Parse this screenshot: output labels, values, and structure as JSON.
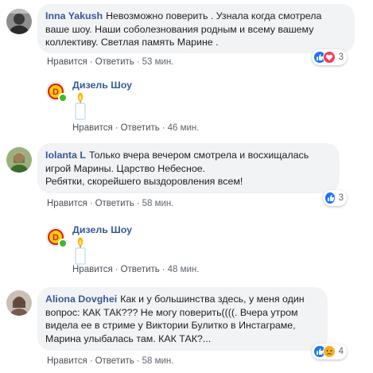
{
  "comments": [
    {
      "author": "Inna Yakush",
      "text": "Невозможно поверить . Узнала когда смотрела ваше шоу. Наши соболезнования родным и всему вашему коллективу. Светлая память Марине .",
      "like_label": "Нравится",
      "reply_label": "Ответить",
      "time": "53 мин.",
      "reactions": [
        "like",
        "love"
      ],
      "reaction_count": "3",
      "reply": {
        "author": "Дизель Шоу",
        "content_icon": "candle-sticker",
        "like_label": "Нравится",
        "reply_label": "Ответить",
        "time": "46 мин."
      }
    },
    {
      "author": "Iolanta L",
      "text_line1": "Только вчера вечером смотрела и восхищалась игрой Марины. Царство Небесное.",
      "text_line2": "Ребятки, скорейшего выздоровления всем!",
      "like_label": "Нравится",
      "reply_label": "Ответить",
      "time": "58 мин.",
      "reactions": [
        "like"
      ],
      "reaction_count": "3",
      "reply": {
        "author": "Дизель Шоу",
        "content_icon": "candle-sticker",
        "like_label": "Нравится",
        "reply_label": "Ответить",
        "time": "48 мин."
      }
    },
    {
      "author": "Aliona Dovghei",
      "text": "Как и у большинства здесь, у меня один вопрос: КАК ТАК??? Не могу поверить((((. Вчера утром видела ее в стриме у Виктории Булитко в Инстаграме, Марина улыбалась там. КАК ТАК?...",
      "like_label": "Нравится",
      "reply_label": "Ответить",
      "time": "58 мин.",
      "reactions": [
        "like",
        "sad"
      ],
      "reaction_count": "4"
    }
  ],
  "separator": "·",
  "colors": {
    "author": "#385898",
    "bubble": "#f2f3f5",
    "like_reaction": "#1877f2",
    "love_reaction": "#f33e58",
    "sad_reaction": "#f7b125",
    "online": "#42b72a"
  }
}
